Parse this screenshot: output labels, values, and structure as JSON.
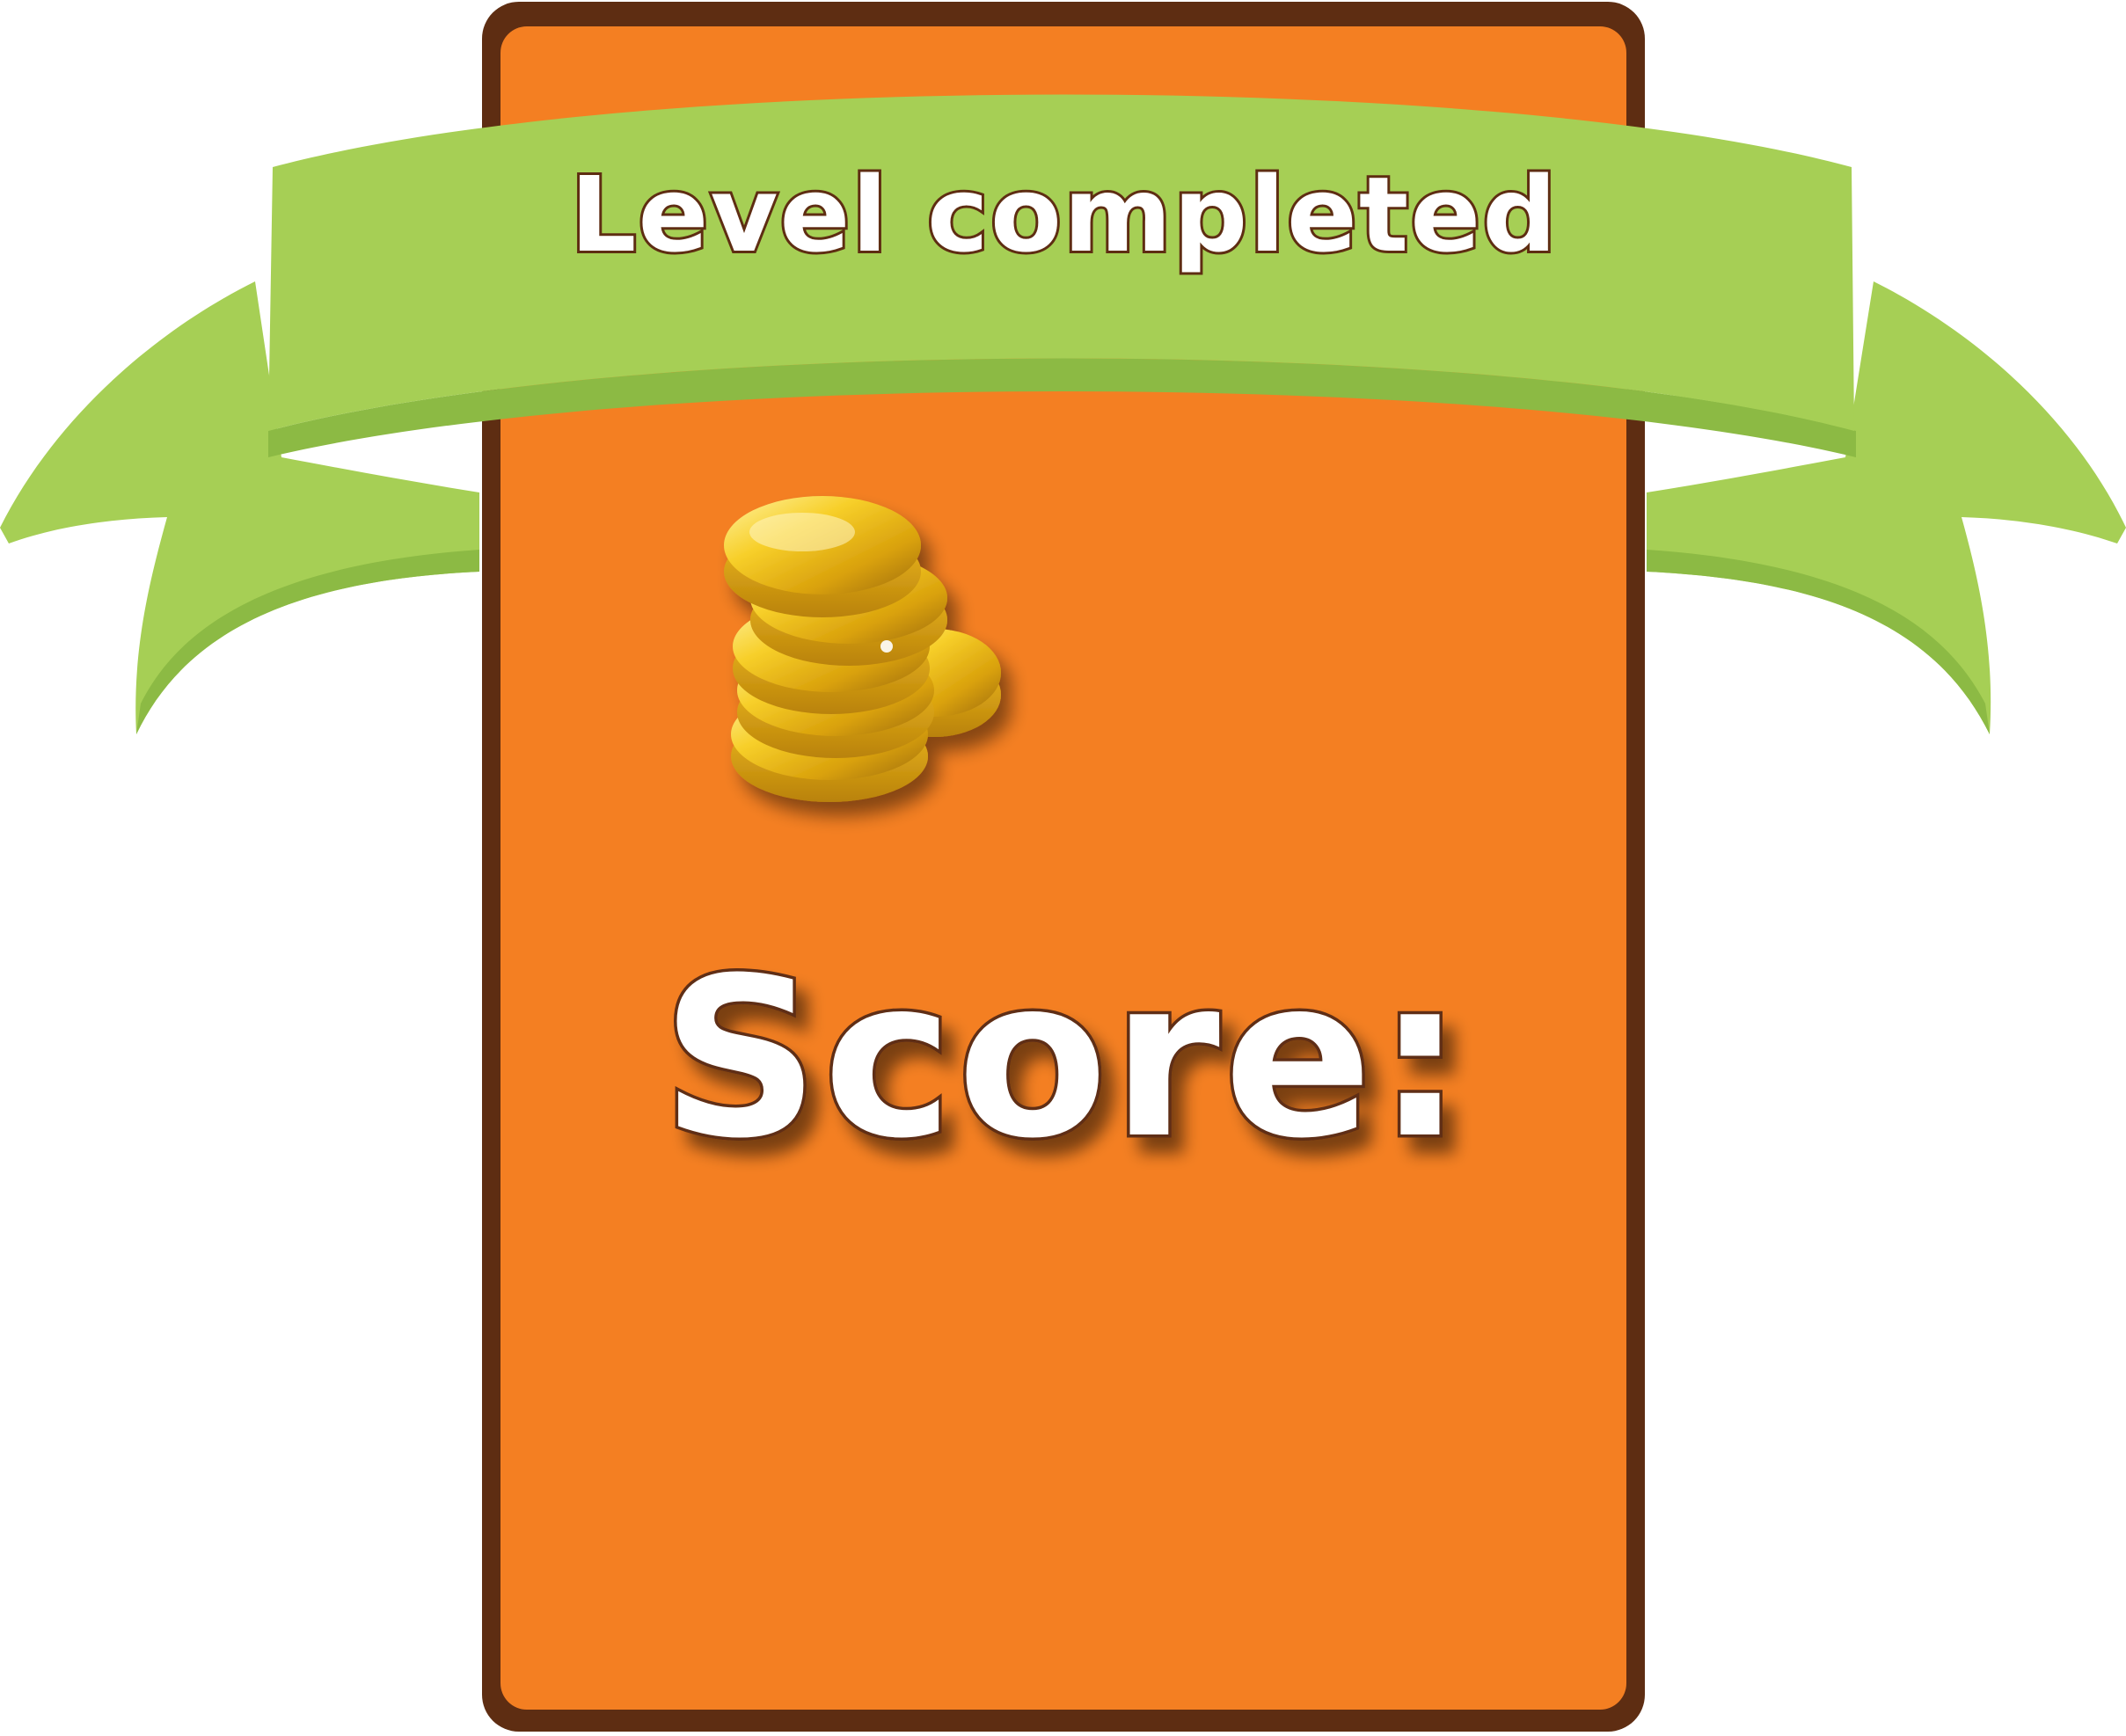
{
  "banner": {
    "title": "Level completed"
  },
  "panel": {
    "score_label": "Score:",
    "coin_icon": "gold-coin-stack-icon"
  },
  "colors": {
    "panel_orange": "#f47f22",
    "panel_border": "#5e2d12",
    "ribbon_green": "#a6cf55",
    "ribbon_shadow": "#8cba44",
    "coin_gold": "#f2c21b",
    "text_fill": "#ffffff",
    "text_outline": "#5e2d12"
  }
}
